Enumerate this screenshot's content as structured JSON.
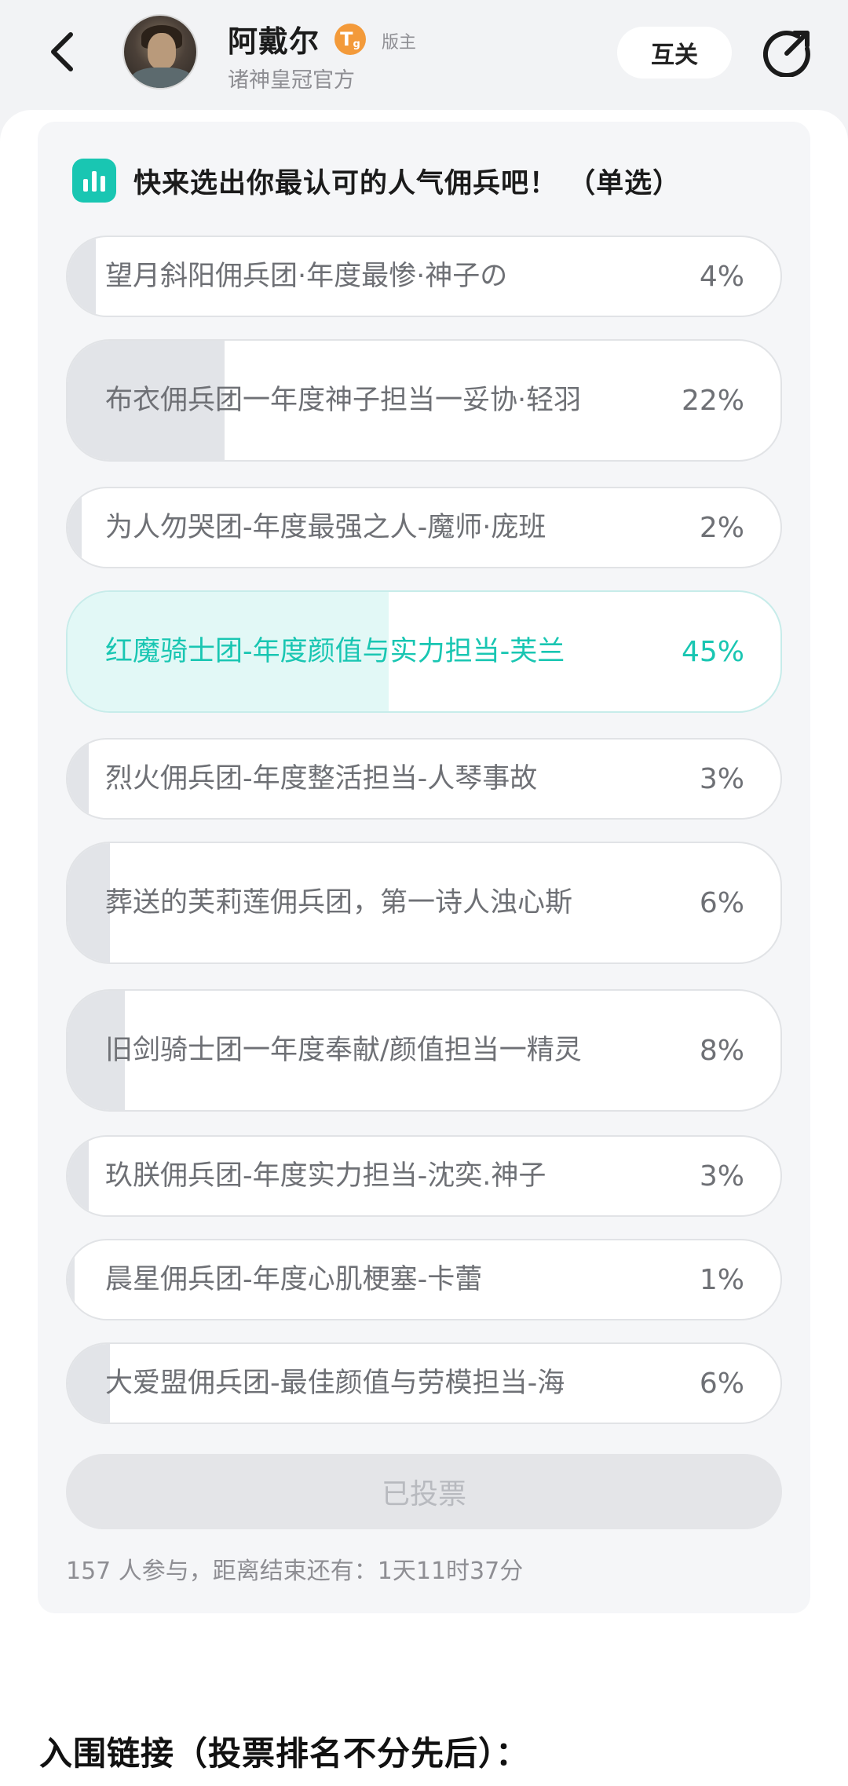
{
  "header": {
    "user_name": "阿戴尔",
    "level_badge": "Tg",
    "role_tag": "版主",
    "subtitle": "诸神皇冠官方",
    "follow_label": "互关"
  },
  "poll": {
    "title": "快来选出你最认可的人气佣兵吧！ （单选）",
    "options": [
      {
        "label": "望月斜阳佣兵团·年度最惨·神子の",
        "percent": "4%",
        "value": 4,
        "selected": false
      },
      {
        "label": "布衣佣兵团一年度神子担当一妥协·轻羽",
        "percent": "22%",
        "value": 22,
        "selected": false
      },
      {
        "label": "为人勿哭团-年度最强之人-魔师·庞班",
        "percent": "2%",
        "value": 2,
        "selected": false
      },
      {
        "label": "红魔骑士团-年度颜值与实力担当-芙兰",
        "percent": "45%",
        "value": 45,
        "selected": true
      },
      {
        "label": "烈火佣兵团-年度整活担当-人琴事故",
        "percent": "3%",
        "value": 3,
        "selected": false
      },
      {
        "label": " 葬送的芙莉莲佣兵团，第一诗人浊心斯",
        "percent": "6%",
        "value": 6,
        "selected": false
      },
      {
        "label": "旧剑骑士团一年度奉献/颜值担当一精灵",
        "percent": "8%",
        "value": 8,
        "selected": false
      },
      {
        "label": "玖朕佣兵团-年度实力担当-沈奕.神子",
        "percent": "3%",
        "value": 3,
        "selected": false
      },
      {
        "label": "晨星佣兵团-年度心肌梗塞-卡蕾",
        "percent": "1%",
        "value": 1,
        "selected": false
      },
      {
        "label": "大爱盟佣兵团-最佳颜值与劳模担当-海",
        "percent": "6%",
        "value": 6,
        "selected": false
      }
    ],
    "voted_label": "已投票",
    "footer": "157 人参与，距离结束还有：1天11时37分"
  },
  "section_heading": "入围链接（投票排名不分先后）：",
  "colors": {
    "accent": "#19c6b2",
    "bar_fill": "#e2e4e8",
    "selected_fill": "#e2f8f6"
  }
}
